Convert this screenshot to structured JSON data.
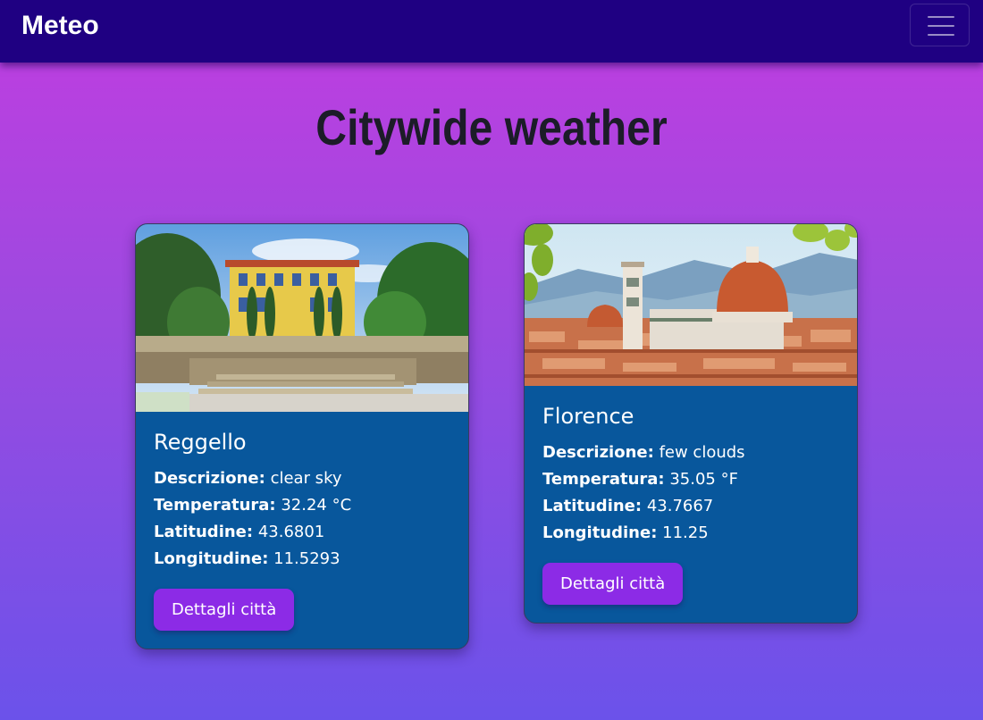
{
  "navbar": {
    "brand": "Meteo",
    "toggler_icon": "hamburger-menu-icon"
  },
  "page": {
    "title": "Citywide weather"
  },
  "labels": {
    "description": "Descrizione:",
    "temperature": "Temperatura:",
    "latitude": "Latitudine:",
    "longitude": "Longitudine:",
    "details_button": "Dettagli città"
  },
  "cities": [
    {
      "name": "Reggello",
      "description": "clear sky",
      "temperature": "32.24 °C",
      "latitude": "43.6801",
      "longitude": "11.5293"
    },
    {
      "name": "Florence",
      "description": "few clouds",
      "temperature": "35.05 °F",
      "latitude": "43.7667",
      "longitude": "11.25"
    }
  ],
  "colors": {
    "navbar": "#1f0082",
    "card": "#08579c",
    "button": "#8c2be6",
    "title": "#1c1c28"
  }
}
